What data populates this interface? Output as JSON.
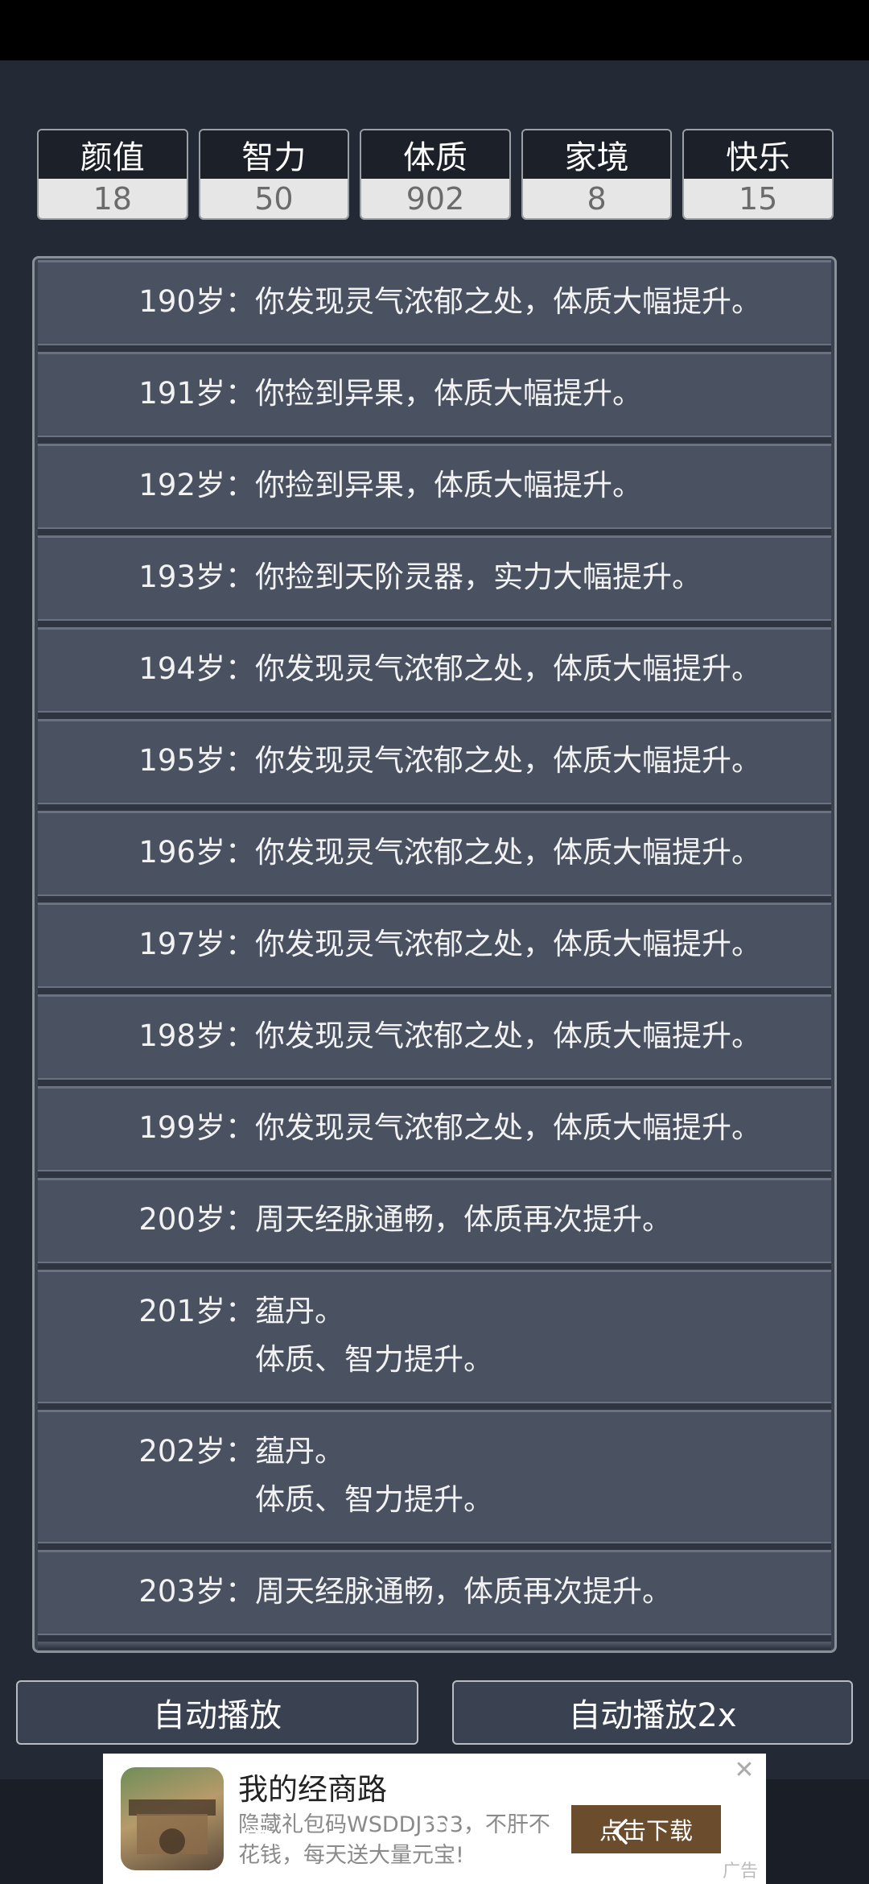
{
  "stats": [
    {
      "label": "颜值",
      "value": "18"
    },
    {
      "label": "智力",
      "value": "50"
    },
    {
      "label": "体质",
      "value": "902"
    },
    {
      "label": "家境",
      "value": "8"
    },
    {
      "label": "快乐",
      "value": "15"
    }
  ],
  "log": [
    {
      "age": "190岁：",
      "text": "你发现灵气浓郁之处，体质大幅提升。",
      "text2": ""
    },
    {
      "age": "191岁：",
      "text": "你捡到异果，体质大幅提升。",
      "text2": ""
    },
    {
      "age": "192岁：",
      "text": "你捡到异果，体质大幅提升。",
      "text2": ""
    },
    {
      "age": "193岁：",
      "text": "你捡到天阶灵器，实力大幅提升。",
      "text2": ""
    },
    {
      "age": "194岁：",
      "text": "你发现灵气浓郁之处，体质大幅提升。",
      "text2": ""
    },
    {
      "age": "195岁：",
      "text": "你发现灵气浓郁之处，体质大幅提升。",
      "text2": ""
    },
    {
      "age": "196岁：",
      "text": "你发现灵气浓郁之处，体质大幅提升。",
      "text2": ""
    },
    {
      "age": "197岁：",
      "text": "你发现灵气浓郁之处，体质大幅提升。",
      "text2": ""
    },
    {
      "age": "198岁：",
      "text": "你发现灵气浓郁之处，体质大幅提升。",
      "text2": ""
    },
    {
      "age": "199岁：",
      "text": "你发现灵气浓郁之处，体质大幅提升。",
      "text2": ""
    },
    {
      "age": "200岁：",
      "text": "周天经脉通畅，体质再次提升。",
      "text2": ""
    },
    {
      "age": "201岁：",
      "text": "蕴丹。",
      "text2": "体质、智力提升。"
    },
    {
      "age": "202岁：",
      "text": "蕴丹。",
      "text2": "体质、智力提升。"
    },
    {
      "age": "203岁：",
      "text": "周天经脉通畅，体质再次提升。",
      "text2": ""
    }
  ],
  "buttons": {
    "auto_play": "自动播放",
    "auto_play_2x": "自动播放2x"
  },
  "ad": {
    "title": "我的经商路",
    "desc": "隐藏礼包码WSDDJ333，不肝不花钱，每天送大量元宝!",
    "cta": "点击下载",
    "close": "✕",
    "badge": "广告"
  }
}
